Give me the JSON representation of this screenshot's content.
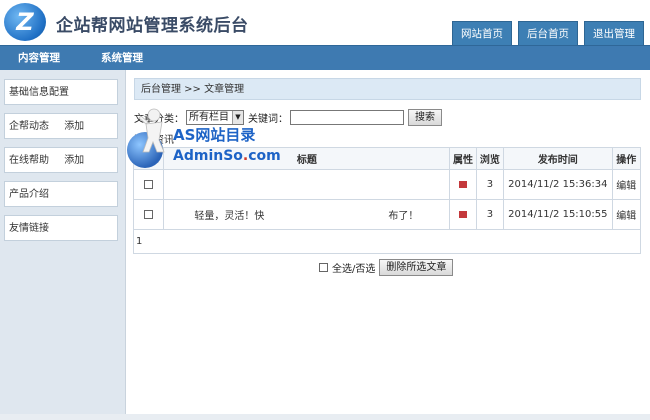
{
  "header": {
    "logo_letter": "Z",
    "title": "企站帮网站管理系统后台",
    "links": [
      "网站首页",
      "后台首页",
      "退出管理"
    ]
  },
  "nav": {
    "items": [
      "内容管理",
      "系统管理"
    ]
  },
  "sidebar": {
    "items": [
      {
        "label": "基础信息配置",
        "add": ""
      },
      {
        "label": "企帮动态",
        "add": "添加"
      },
      {
        "label": "在线帮助",
        "add": "添加"
      },
      {
        "label": "产品介绍",
        "add": ""
      },
      {
        "label": "友情链接",
        "add": ""
      }
    ]
  },
  "main": {
    "breadcrumb": "后台管理 >> 文章管理",
    "filter": {
      "category_label": "文章分类：",
      "category_selected": "所有栏目",
      "keyword_label": "关键词：",
      "keyword_value": "",
      "search_button": "搜索"
    },
    "add_link": "添加资讯",
    "table": {
      "headers": [
        "选择",
        "标题",
        "属性",
        "浏览",
        "发布时间",
        "操作"
      ],
      "rows": [
        {
          "title": "",
          "views": "3",
          "time": "2014/11/2 15:36:34",
          "action": "编辑"
        },
        {
          "title": "轻量，灵活！快",
          "title_tail": "布了！",
          "views": "3",
          "time": "2014/11/2 15:10:55",
          "action": "编辑"
        }
      ],
      "pager": "1"
    },
    "bottom": {
      "select_all_label": "全选/否选",
      "delete_button": "删除所选文章"
    }
  },
  "watermark": {
    "line1": "AS网站目录",
    "line2_a": "AdminSo",
    "line2_dot": ".",
    "line2_b": "com"
  },
  "colors": {
    "nav_bar": "#3e7ab1",
    "top_link": "#3d7fb4",
    "sidebar_bg": "#dfe7ef",
    "breadcrumb_bg": "#dce9f5",
    "attr_icon": "#c4383b"
  }
}
